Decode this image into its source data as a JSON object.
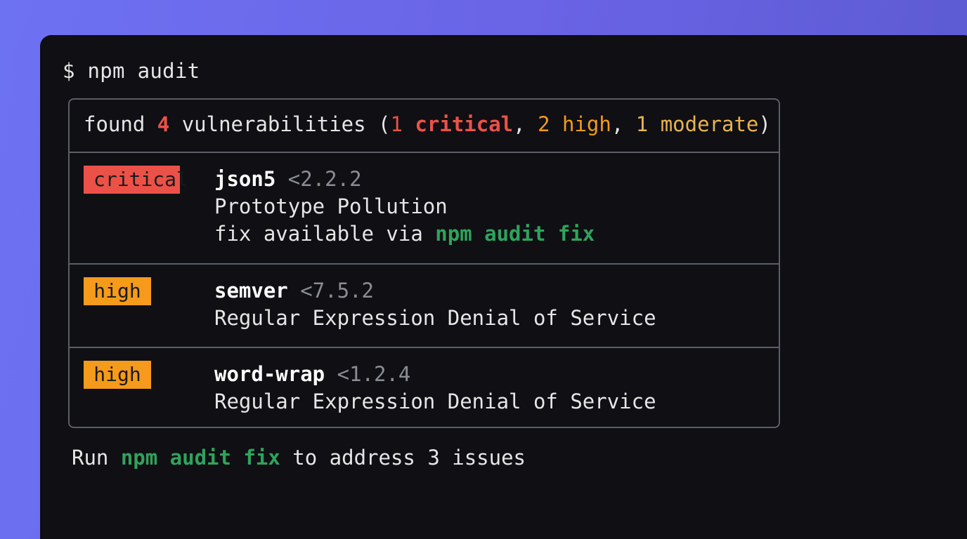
{
  "terminal": {
    "prompt": "$",
    "command": "npm audit"
  },
  "summary": {
    "prefix": "found ",
    "count": "4",
    "mid": " vulnerabilities (",
    "critical_count": "1",
    "critical_label": "critical",
    "sep1": ", ",
    "high_count": "2",
    "high_label": "high",
    "sep2": ", ",
    "moderate_count": "1",
    "moderate_label": "moderate",
    "suffix": ")"
  },
  "vulnerabilities": [
    {
      "severity": "critical",
      "package": "json5",
      "range": "<2.2.2",
      "title": "Prototype Pollution",
      "fix_prefix": "fix available via ",
      "fix_command": "npm audit fix"
    },
    {
      "severity": "high",
      "package": "semver",
      "range": "<7.5.2",
      "title": "Regular Expression Denial of Service"
    },
    {
      "severity": "high",
      "package": "word-wrap",
      "range": "<1.2.4",
      "title": "Regular Expression Denial of Service"
    }
  ],
  "footer": {
    "prefix": "Run ",
    "command": "npm audit fix",
    "suffix": " to address 3 issues"
  },
  "colors": {
    "critical": "#ec5148",
    "high": "#f59a1a",
    "moderate": "#e8b450",
    "command_green": "#2fa35a",
    "terminal_bg": "#0f0f14"
  }
}
